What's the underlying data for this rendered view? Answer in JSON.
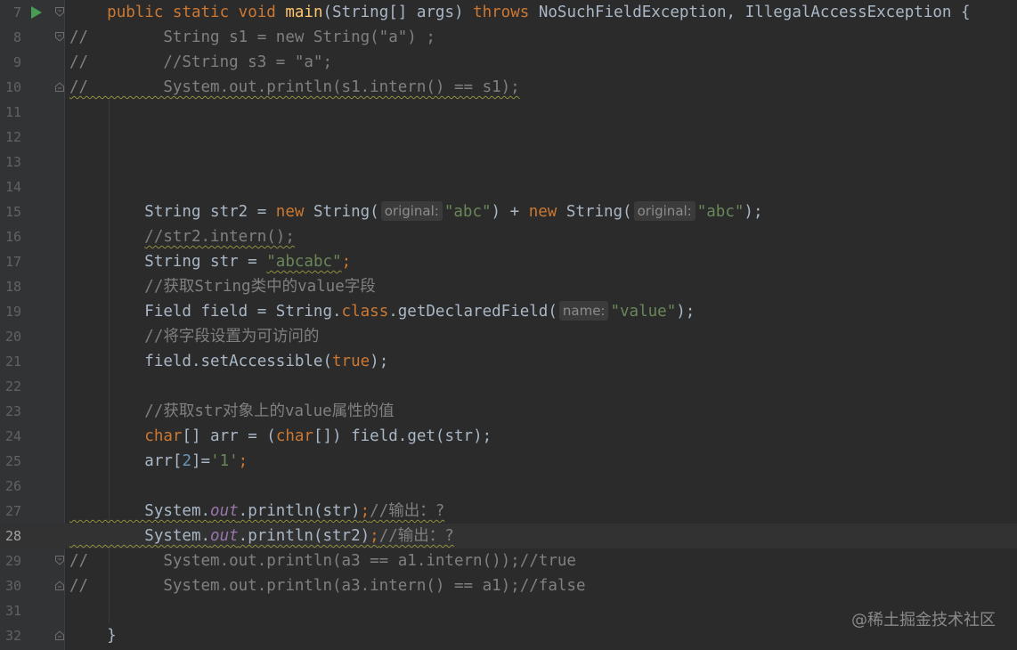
{
  "editor": {
    "lines": [
      {
        "num": "7",
        "run": true,
        "fold": "open",
        "segments": [
          {
            "t": "    ",
            "c": ""
          },
          {
            "t": "public static void ",
            "c": "kw"
          },
          {
            "t": "main",
            "c": "fn"
          },
          {
            "t": "(String[] args) ",
            "c": ""
          },
          {
            "t": "throws ",
            "c": "kw"
          },
          {
            "t": "NoSuchFieldException, IllegalAccessException {",
            "c": ""
          }
        ]
      },
      {
        "num": "8",
        "fold": "open",
        "segments": [
          {
            "t": "//        String s1 = new String(\"a\") ;",
            "c": "cm"
          }
        ]
      },
      {
        "num": "9",
        "segments": [
          {
            "t": "//        //String s3 = \"a\";",
            "c": "cm"
          }
        ]
      },
      {
        "num": "10",
        "fold": "close",
        "segments": [
          {
            "t": "//        System.out.println(s1.intern() == s1);",
            "c": "cm wavy"
          }
        ]
      },
      {
        "num": "11",
        "segments": []
      },
      {
        "num": "12",
        "segments": []
      },
      {
        "num": "13",
        "segments": []
      },
      {
        "num": "14",
        "segments": []
      },
      {
        "num": "15",
        "segments": [
          {
            "t": "        String str2 = ",
            "c": ""
          },
          {
            "t": "new ",
            "c": "kw"
          },
          {
            "t": "String(",
            "c": ""
          },
          {
            "t": "original:",
            "c": "hint"
          },
          {
            "t": "\"abc\"",
            "c": "str"
          },
          {
            "t": ") + ",
            "c": ""
          },
          {
            "t": "new ",
            "c": "kw"
          },
          {
            "t": "String(",
            "c": ""
          },
          {
            "t": "original:",
            "c": "hint"
          },
          {
            "t": "\"abc\"",
            "c": "str"
          },
          {
            "t": ");",
            "c": ""
          }
        ]
      },
      {
        "num": "16",
        "segments": [
          {
            "t": "        ",
            "c": ""
          },
          {
            "t": "//str2.intern();",
            "c": "cm wavy"
          }
        ]
      },
      {
        "num": "17",
        "segments": [
          {
            "t": "        String str = ",
            "c": ""
          },
          {
            "t": "\"abcabc\"",
            "c": "str wavy"
          },
          {
            "t": ";",
            "c": "kw"
          }
        ]
      },
      {
        "num": "18",
        "segments": [
          {
            "t": "        //获取String类中的value字段",
            "c": "cm"
          }
        ]
      },
      {
        "num": "19",
        "segments": [
          {
            "t": "        Field field = String.",
            "c": ""
          },
          {
            "t": "class",
            "c": "kw"
          },
          {
            "t": ".getDeclaredField(",
            "c": ""
          },
          {
            "t": "name:",
            "c": "hint"
          },
          {
            "t": "\"value\"",
            "c": "str"
          },
          {
            "t": ");",
            "c": ""
          }
        ]
      },
      {
        "num": "20",
        "segments": [
          {
            "t": "        //将字段设置为可访问的",
            "c": "cm"
          }
        ]
      },
      {
        "num": "21",
        "segments": [
          {
            "t": "        field.setAccessible(",
            "c": ""
          },
          {
            "t": "true",
            "c": "kw"
          },
          {
            "t": ");",
            "c": ""
          }
        ]
      },
      {
        "num": "22",
        "segments": []
      },
      {
        "num": "23",
        "segments": [
          {
            "t": "        //获取str对象上的value属性的值",
            "c": "cm"
          }
        ]
      },
      {
        "num": "24",
        "segments": [
          {
            "t": "        ",
            "c": ""
          },
          {
            "t": "char",
            "c": "kw"
          },
          {
            "t": "[] arr = (",
            "c": ""
          },
          {
            "t": "char",
            "c": "kw"
          },
          {
            "t": "[]) field.get(str);",
            "c": ""
          }
        ]
      },
      {
        "num": "25",
        "segments": [
          {
            "t": "        arr[",
            "c": ""
          },
          {
            "t": "2",
            "c": "num"
          },
          {
            "t": "]=",
            "c": ""
          },
          {
            "t": "'1'",
            "c": "str"
          },
          {
            "t": ";",
            "c": "kw"
          }
        ]
      },
      {
        "num": "26",
        "segments": []
      },
      {
        "num": "27",
        "segments": [
          {
            "t": "        System.",
            "c": "wavy"
          },
          {
            "t": "out",
            "c": "stat wavy"
          },
          {
            "t": ".println(str)",
            "c": "wavy"
          },
          {
            "t": ";",
            "c": "kw wavy"
          },
          {
            "t": "//输出：?",
            "c": "cm wavy"
          }
        ]
      },
      {
        "num": "28",
        "current": true,
        "segments": [
          {
            "t": "        System.",
            "c": "wavy"
          },
          {
            "t": "out",
            "c": "stat wavy"
          },
          {
            "t": ".println(str2)",
            "c": "wavy"
          },
          {
            "t": ";",
            "c": "kw wavy"
          },
          {
            "t": "//输出：?",
            "c": "cm wavy"
          }
        ]
      },
      {
        "num": "29",
        "fold": "open",
        "segments": [
          {
            "t": "//        System.out.println(a3 == a1.intern());//true",
            "c": "cm"
          }
        ]
      },
      {
        "num": "30",
        "fold": "close",
        "segments": [
          {
            "t": "//        System.out.println(a3.intern() == a1);//false",
            "c": "cm"
          }
        ]
      },
      {
        "num": "31",
        "segments": []
      },
      {
        "num": "32",
        "fold": "close",
        "segments": [
          {
            "t": "    }",
            "c": ""
          }
        ]
      }
    ]
  },
  "watermark": "@稀土掘金技术社区",
  "colors": {
    "background": "#2b2b2b",
    "gutter": "#313335",
    "keyword": "#cc7832",
    "string": "#6a8759",
    "comment": "#808080",
    "function": "#ffc66d",
    "number": "#6897bb",
    "static_field": "#9876aa",
    "run_icon": "#499c54"
  },
  "icons": {
    "run": "run-gutter-icon",
    "fold_open": "fold-open-icon",
    "fold_close": "fold-close-icon"
  }
}
